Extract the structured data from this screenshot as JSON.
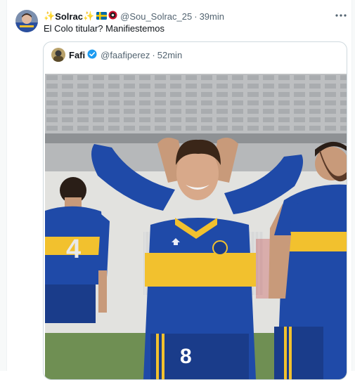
{
  "tweet": {
    "display_name": "Solrac",
    "sparkle_left": "✨",
    "sparkle_right": "✨",
    "flag_icon": "sweden-flag-icon",
    "badge_icon": "club-crest-icon",
    "handle": "@Sou_Solrac_25",
    "separator": "·",
    "time": "39min",
    "text": "El Colo titular? Manifiestemos",
    "more_icon": "more-horizontal-icon"
  },
  "quote": {
    "display_name": "Fafi",
    "verified_icon": "verified-badge-icon",
    "handle": "@faafiperez",
    "separator": "·",
    "time": "52min"
  },
  "photo": {
    "jersey_number_center": "8",
    "jersey_number_left": "4"
  },
  "colors": {
    "accent": "#1d9bf0",
    "boca_blue": "#1b3f94",
    "boca_yellow": "#f2c12e",
    "text_primary": "#0f1419",
    "text_secondary": "#536471",
    "border": "#cfd9de"
  }
}
